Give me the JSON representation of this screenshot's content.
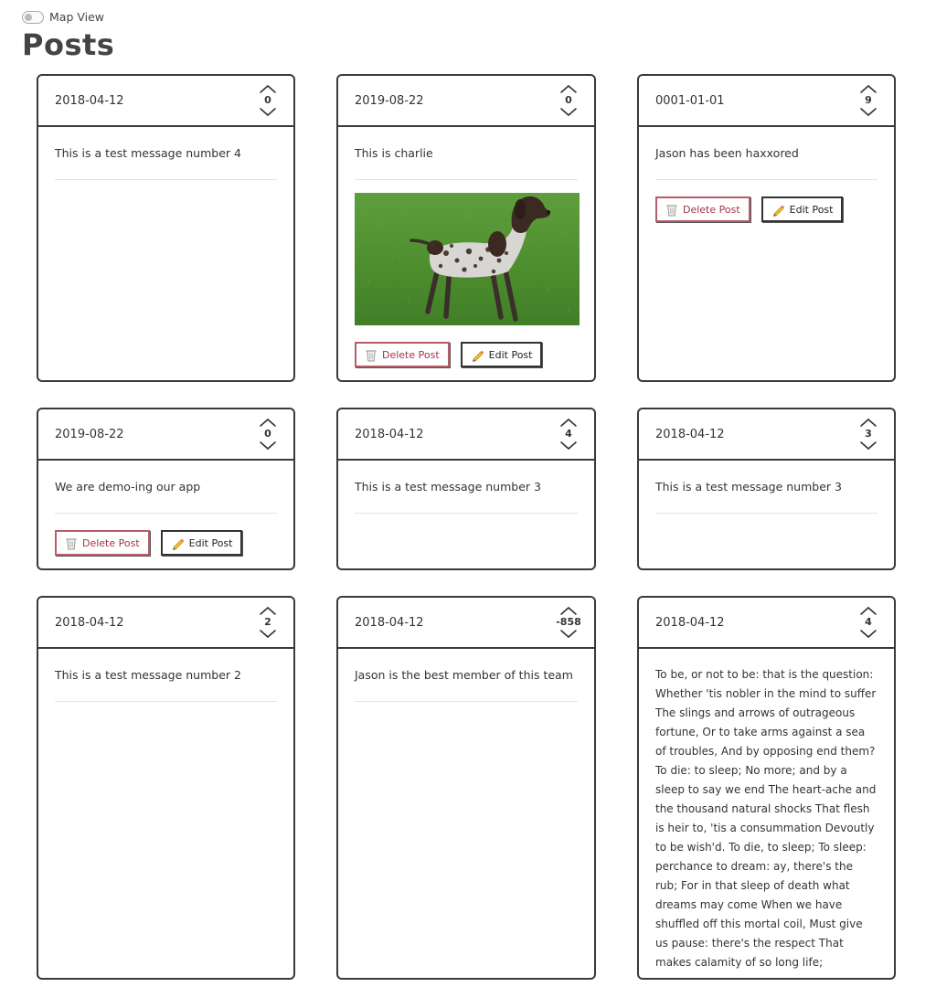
{
  "header": {
    "toggle_label": "Map View",
    "title": "Posts"
  },
  "buttons": {
    "delete_label": "Delete Post",
    "edit_label": "Edit Post"
  },
  "posts": [
    {
      "date": "2018-04-12",
      "votes": "0",
      "message": "This is a test message number 4"
    },
    {
      "date": "2019-08-22",
      "votes": "0",
      "message": "This is charlie",
      "image": "photo of a spotted dog standing on grass"
    },
    {
      "date": "0001-01-01",
      "votes": "9",
      "message": "Jason has been haxxored"
    },
    {
      "date": "2019-08-22",
      "votes": "0",
      "message": "We are demo-ing our app"
    },
    {
      "date": "2018-04-12",
      "votes": "4",
      "message": "This is a test message number 3"
    },
    {
      "date": "2018-04-12",
      "votes": "3",
      "message": "This is a test message number 3"
    },
    {
      "date": "2018-04-12",
      "votes": "2",
      "message": "This is a test message number 2"
    },
    {
      "date": "2018-04-12",
      "votes": "-858",
      "message": "Jason is the best member of this team"
    },
    {
      "date": "2018-04-12",
      "votes": "4",
      "message": "To be, or not to be: that is the question: Whether 'tis nobler in the mind to suffer The slings and arrows of outrageous fortune, Or to take arms against a sea of troubles, And by opposing end them? To die: to sleep; No more; and by a sleep to say we end The heart-ache and the thousand natural shocks That flesh is heir to, 'tis a consummation Devoutly to be wish'd. To die, to sleep; To sleep: perchance to dream: ay, there's the rub; For in that sleep of death what dreams may come When we have shuffled off this mortal coil, Must give us pause: there's the respect That makes calamity of so long life;"
    }
  ]
}
